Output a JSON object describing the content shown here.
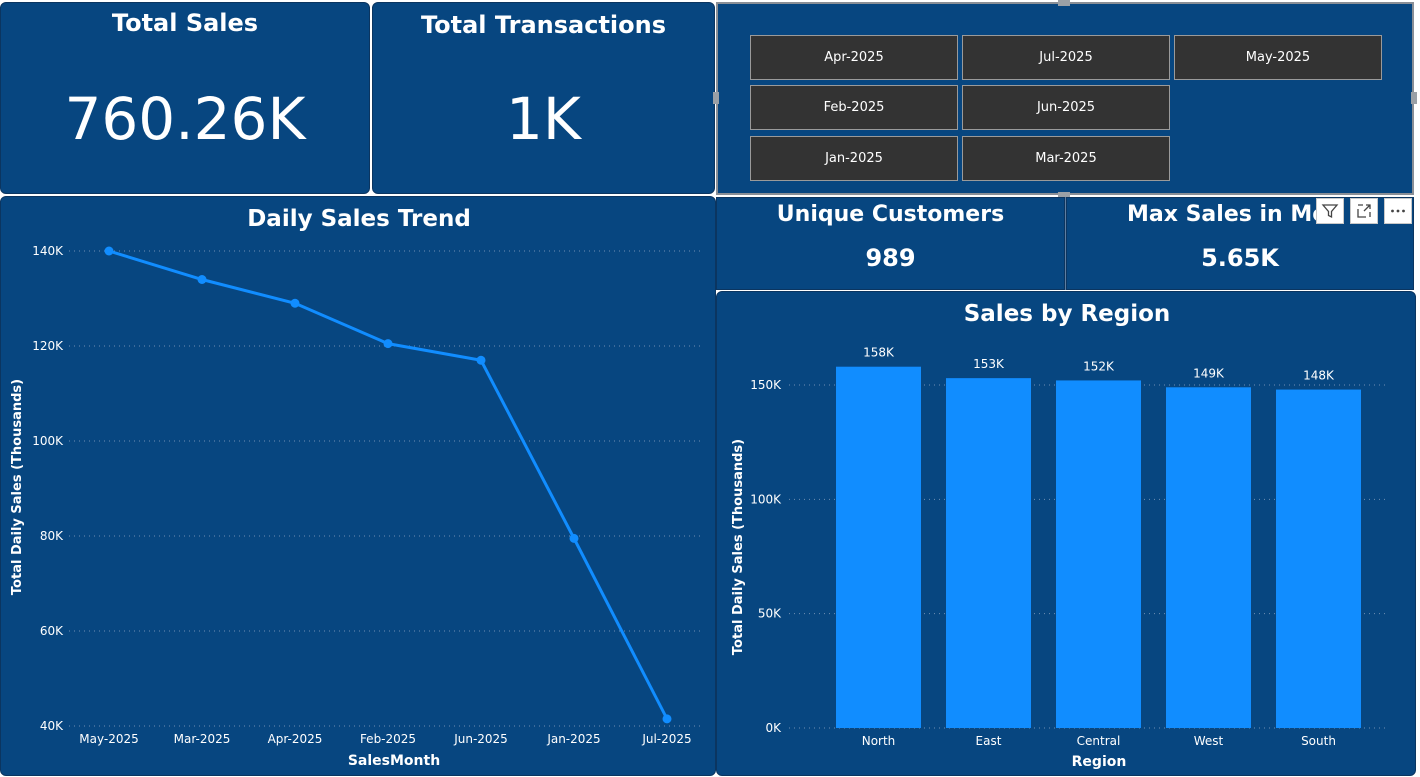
{
  "kpis": {
    "total_sales": {
      "title": "Total Sales",
      "value": "760.26K"
    },
    "total_transactions": {
      "title": "Total Transactions",
      "value": "1K"
    },
    "unique_customers": {
      "title": "Unique Customers",
      "value": "989"
    },
    "max_sales": {
      "title": "Max Sales in Mo",
      "value": "5.65K"
    }
  },
  "slicer": {
    "months": [
      "Apr-2025",
      "Jul-2025",
      "May-2025",
      "Feb-2025",
      "Jun-2025",
      "Jan-2025",
      "Mar-2025"
    ]
  },
  "visual_header_icons": [
    "filter-icon",
    "focus-mode-icon",
    "more-options-icon"
  ],
  "colors": {
    "background": "#074680",
    "series": "#118dff",
    "slicer_button": "#333333",
    "text": "#ffffff"
  },
  "chart_data": [
    {
      "type": "line",
      "title": "Daily Sales Trend",
      "xlabel": "SalesMonth",
      "ylabel": "Total Daily Sales (Thousands)",
      "categories": [
        "May-2025",
        "Mar-2025",
        "Apr-2025",
        "Feb-2025",
        "Jun-2025",
        "Jan-2025",
        "Jul-2025"
      ],
      "values": [
        140,
        134,
        129,
        120.5,
        117,
        79.5,
        41.5
      ],
      "ylim": [
        40,
        140
      ],
      "yticks": [
        40,
        60,
        80,
        100,
        120,
        140
      ],
      "ytick_labels": [
        "40K",
        "60K",
        "80K",
        "100K",
        "120K",
        "140K"
      ],
      "grid": true
    },
    {
      "type": "bar",
      "title": "Sales by Region",
      "xlabel": "Region",
      "ylabel": "Total Daily Sales (Thousands)",
      "categories": [
        "North",
        "East",
        "Central",
        "West",
        "South"
      ],
      "values": [
        158,
        153,
        152,
        149,
        148
      ],
      "data_labels": [
        "158K",
        "153K",
        "152K",
        "149K",
        "148K"
      ],
      "ylim": [
        0,
        150
      ],
      "yticks": [
        0,
        50,
        100,
        150
      ],
      "ytick_labels": [
        "0K",
        "50K",
        "100K",
        "150K"
      ],
      "grid": true
    }
  ]
}
